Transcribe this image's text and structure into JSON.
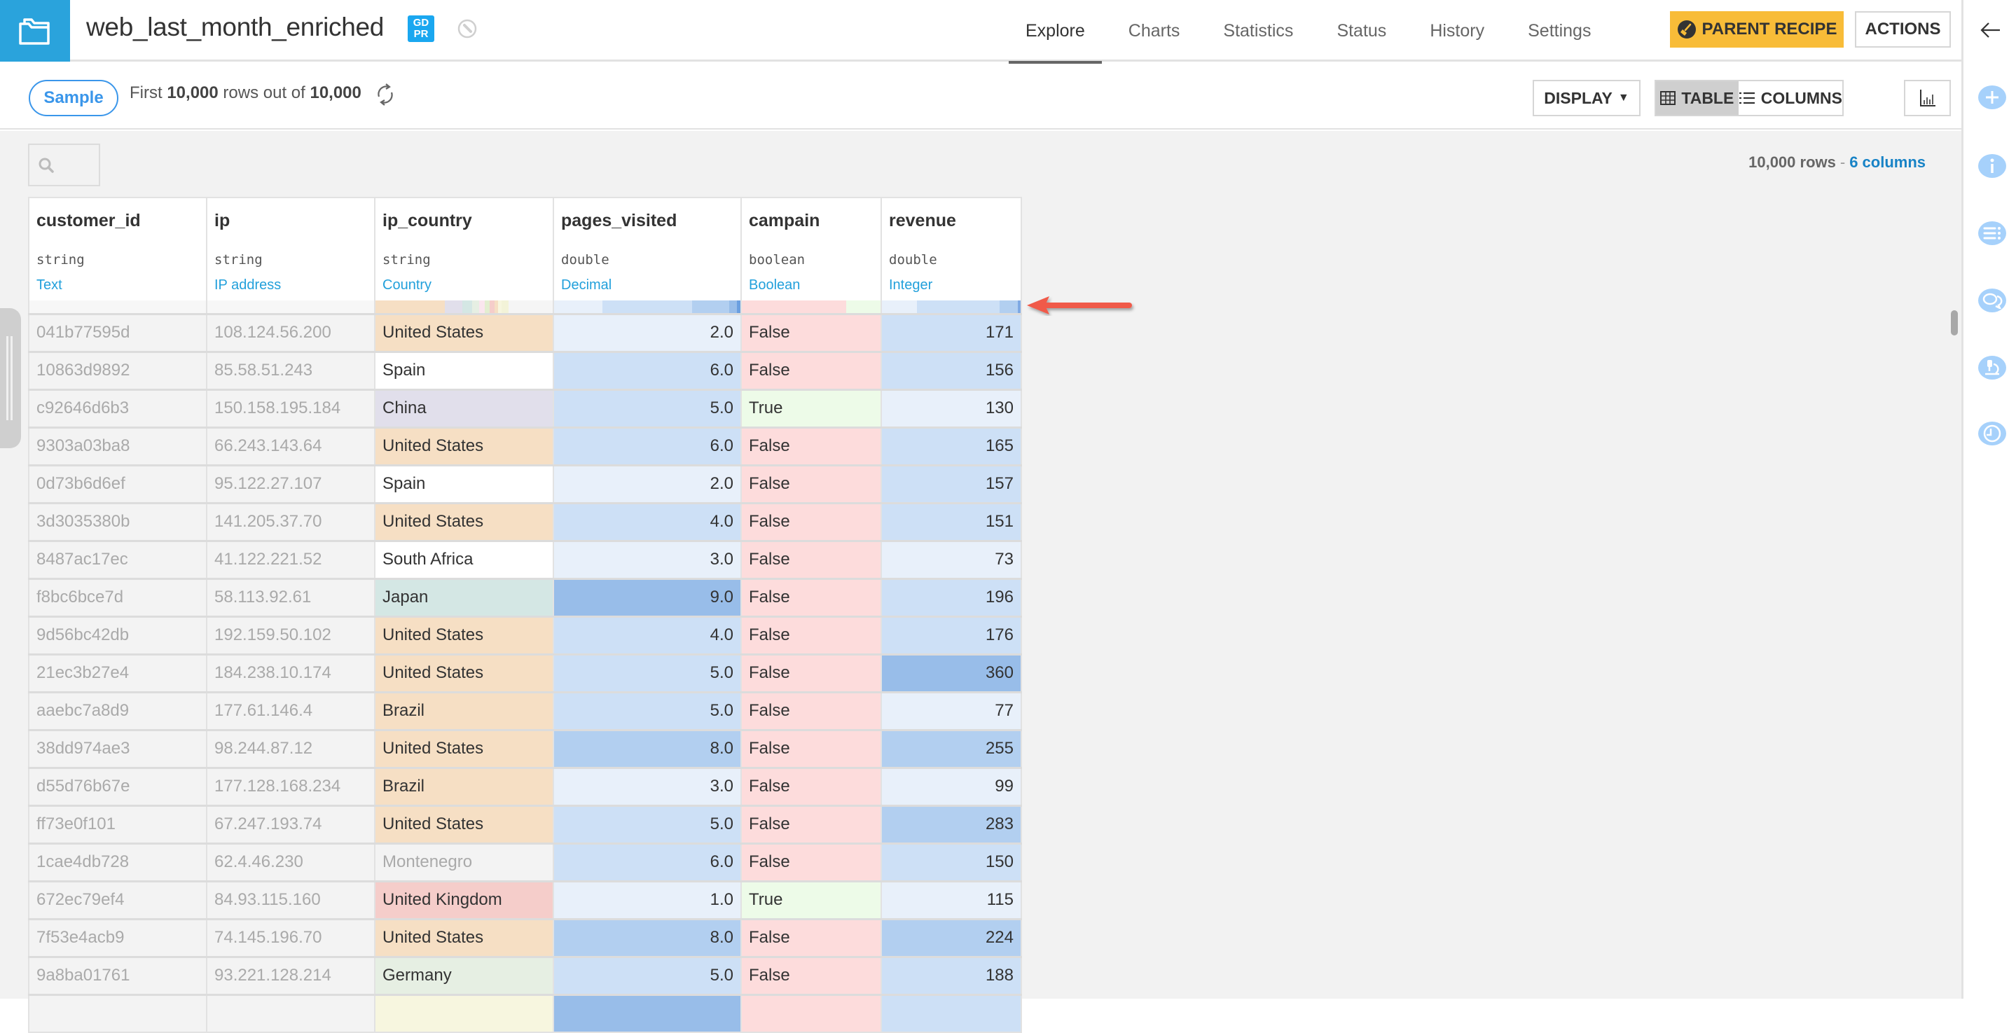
{
  "header": {
    "title": "web_last_month_enriched",
    "gdpr_badge": "GD PR",
    "tabs": [
      {
        "label": "Explore",
        "active": true
      },
      {
        "label": "Charts",
        "active": false
      },
      {
        "label": "Statistics",
        "active": false
      },
      {
        "label": "Status",
        "active": false
      },
      {
        "label": "History",
        "active": false
      },
      {
        "label": "Settings",
        "active": false
      }
    ],
    "parent_recipe_label": "PARENT RECIPE",
    "actions_label": "ACTIONS",
    "accent_color": "#f8bc38",
    "logo_color": "#2aa3dc"
  },
  "subbar": {
    "sample_label": "Sample",
    "sample_prefix": "First ",
    "sample_rows": "10,000",
    "sample_middle": " rows out of ",
    "sample_total": "10,000",
    "display_label": "DISPLAY",
    "table_label": "TABLE",
    "columns_label": "COLUMNS"
  },
  "summary": {
    "rows": "10,000 rows",
    "separator": "-",
    "columns": "6 columns"
  },
  "search": {
    "placeholder": ""
  },
  "columns": [
    {
      "name": "customer_id",
      "type": "string",
      "meaning": "Text"
    },
    {
      "name": "ip",
      "type": "string",
      "meaning": "IP address"
    },
    {
      "name": "ip_country",
      "type": "string",
      "meaning": "Country"
    },
    {
      "name": "pages_visited",
      "type": "double",
      "meaning": "Decimal"
    },
    {
      "name": "campain",
      "type": "boolean",
      "meaning": "Boolean"
    },
    {
      "name": "revenue",
      "type": "double",
      "meaning": "Integer"
    }
  ],
  "rows": [
    [
      "041b77595d",
      "108.124.56.200",
      "United States",
      "2.0",
      "False",
      "171"
    ],
    [
      "10863d9892",
      "85.58.51.243",
      "Spain",
      "6.0",
      "False",
      "156"
    ],
    [
      "c92646d6b3",
      "150.158.195.184",
      "China",
      "5.0",
      "True",
      "130"
    ],
    [
      "9303a03ba8",
      "66.243.143.64",
      "United States",
      "6.0",
      "False",
      "165"
    ],
    [
      "0d73b6d6ef",
      "95.122.27.107",
      "Spain",
      "2.0",
      "False",
      "157"
    ],
    [
      "3d3035380b",
      "141.205.37.70",
      "United States",
      "4.0",
      "False",
      "151"
    ],
    [
      "8487ac17ec",
      "41.122.221.52",
      "South Africa",
      "3.0",
      "False",
      "73"
    ],
    [
      "f8bc6bce7d",
      "58.113.92.61",
      "Japan",
      "9.0",
      "False",
      "196"
    ],
    [
      "9d56bc42db",
      "192.159.50.102",
      "United States",
      "4.0",
      "False",
      "176"
    ],
    [
      "21ec3b27e4",
      "184.238.10.174",
      "United States",
      "5.0",
      "False",
      "360"
    ],
    [
      "aaebc7a8d9",
      "177.61.146.4",
      "Brazil",
      "5.0",
      "False",
      "77"
    ],
    [
      "38dd974ae3",
      "98.244.87.12",
      "United States",
      "8.0",
      "False",
      "255"
    ],
    [
      "d55d76b67e",
      "177.128.168.234",
      "Brazil",
      "3.0",
      "False",
      "99"
    ],
    [
      "ff73e0f101",
      "67.247.193.74",
      "United States",
      "5.0",
      "False",
      "283"
    ],
    [
      "1cae4db728",
      "62.4.46.230",
      "Montenegro",
      "6.0",
      "False",
      "150"
    ],
    [
      "672ec79ef4",
      "84.93.115.160",
      "United Kingdom",
      "1.0",
      "True",
      "115"
    ],
    [
      "7f53e4acb9",
      "74.145.196.70",
      "United States",
      "8.0",
      "False",
      "224"
    ],
    [
      "9a8ba01761",
      "93.221.128.214",
      "Germany",
      "5.0",
      "False",
      "188"
    ],
    [
      "",
      "",
      "",
      "",
      "",
      ""
    ]
  ],
  "colors": {
    "country": {
      "United States": "#f6dfc4",
      "Spain": "#ffffff",
      "China": "#e1dfeb",
      "South Africa": "#ffffff",
      "Japan": "#d4e7e4",
      "Brazil": "#f6dfc4",
      "Montenegro": "#f3f3f3",
      "United Kingdom": "#f5cdca",
      "Germany": "#e6efe3",
      "": "#f7f6df"
    },
    "bool_false": "#fddcdc",
    "bool_true": "#edfbe8",
    "num_scale": [
      "#e8f0fa",
      "#cde0f6",
      "#b2cff0",
      "#98bde9"
    ]
  },
  "right_sidebar": [
    "back-arrow",
    "add",
    "info",
    "details-list",
    "discussions",
    "lab",
    "history"
  ]
}
